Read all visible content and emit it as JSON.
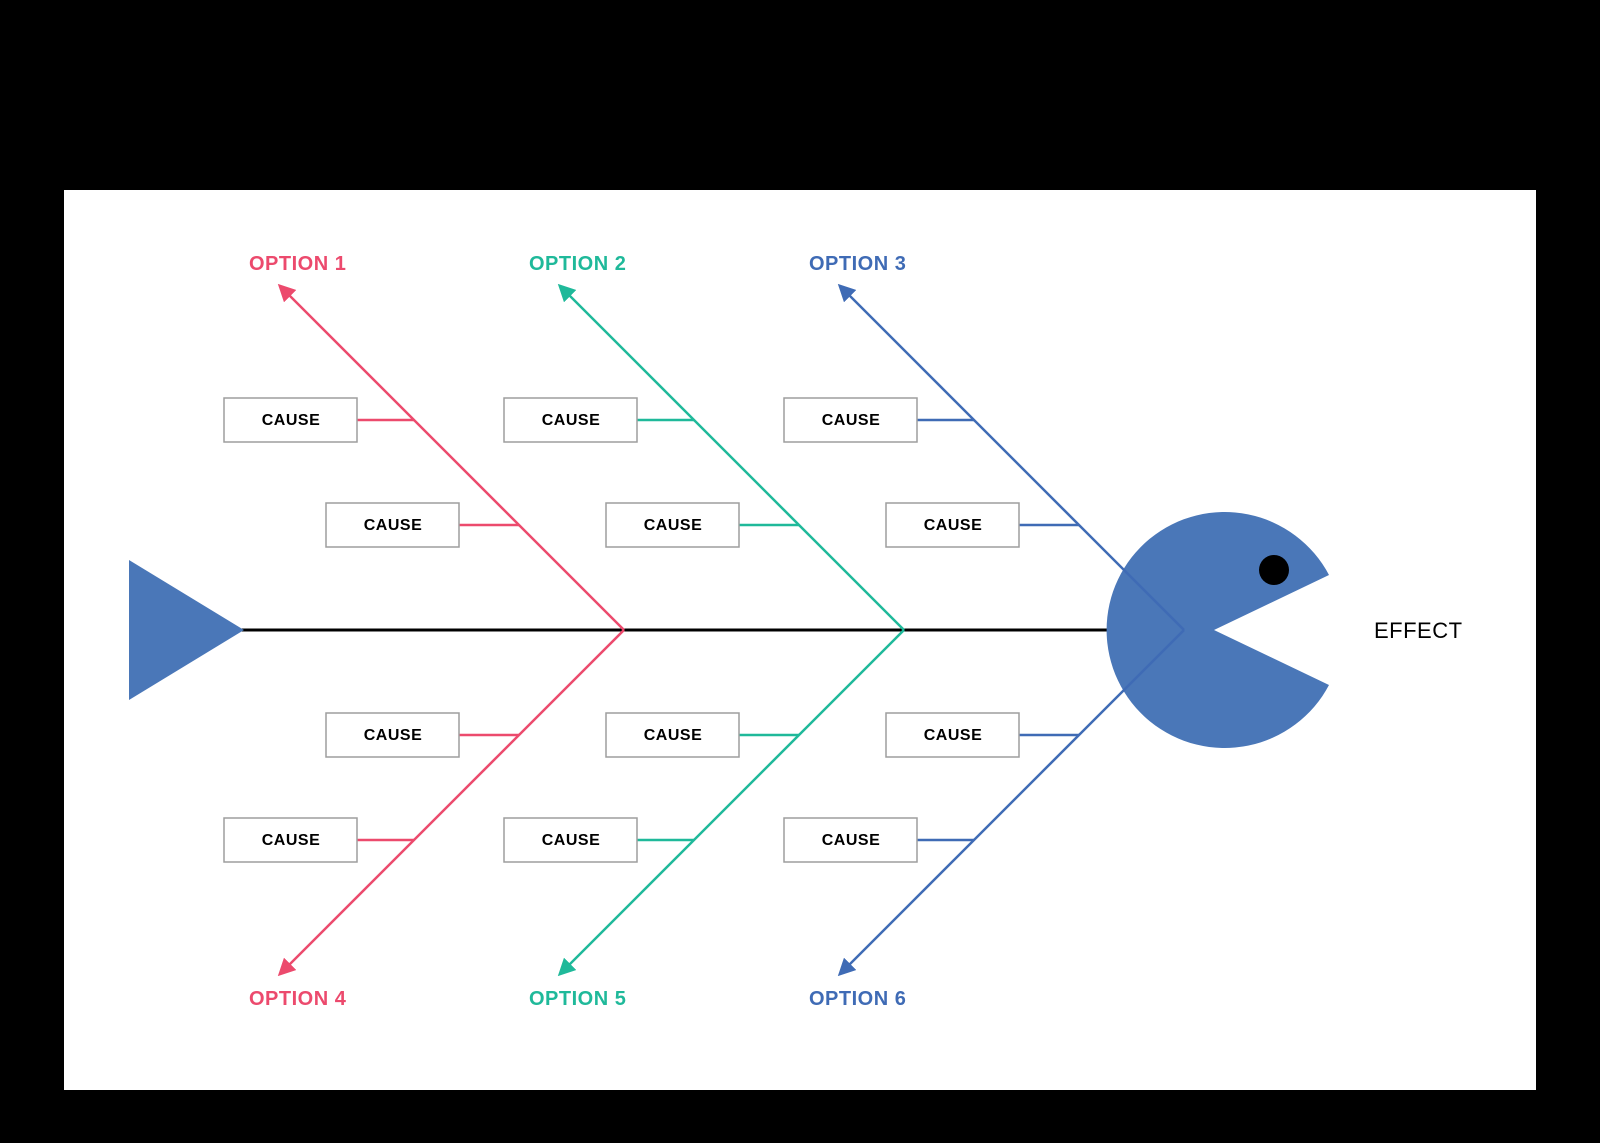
{
  "diagram": {
    "type": "fishbone",
    "effect_label": "EFFECT",
    "colors": {
      "pink": "#ec4a6d",
      "teal": "#1fb99a",
      "blue": "#3f6bb5",
      "fish": "#4a77b8",
      "spine": "#000000",
      "box_border": "#9e9e9e"
    },
    "branches": {
      "top": [
        {
          "label": "OPTION 1",
          "color_key": "pink",
          "causes": [
            "CAUSE",
            "CAUSE"
          ]
        },
        {
          "label": "OPTION 2",
          "color_key": "teal",
          "causes": [
            "CAUSE",
            "CAUSE"
          ]
        },
        {
          "label": "OPTION 3",
          "color_key": "blue",
          "causes": [
            "CAUSE",
            "CAUSE"
          ]
        }
      ],
      "bottom": [
        {
          "label": "OPTION 4",
          "color_key": "pink",
          "causes": [
            "CAUSE",
            "CAUSE"
          ]
        },
        {
          "label": "OPTION 5",
          "color_key": "teal",
          "causes": [
            "CAUSE",
            "CAUSE"
          ]
        },
        {
          "label": "OPTION 6",
          "color_key": "blue",
          "causes": [
            "CAUSE",
            "CAUSE"
          ]
        }
      ]
    }
  }
}
